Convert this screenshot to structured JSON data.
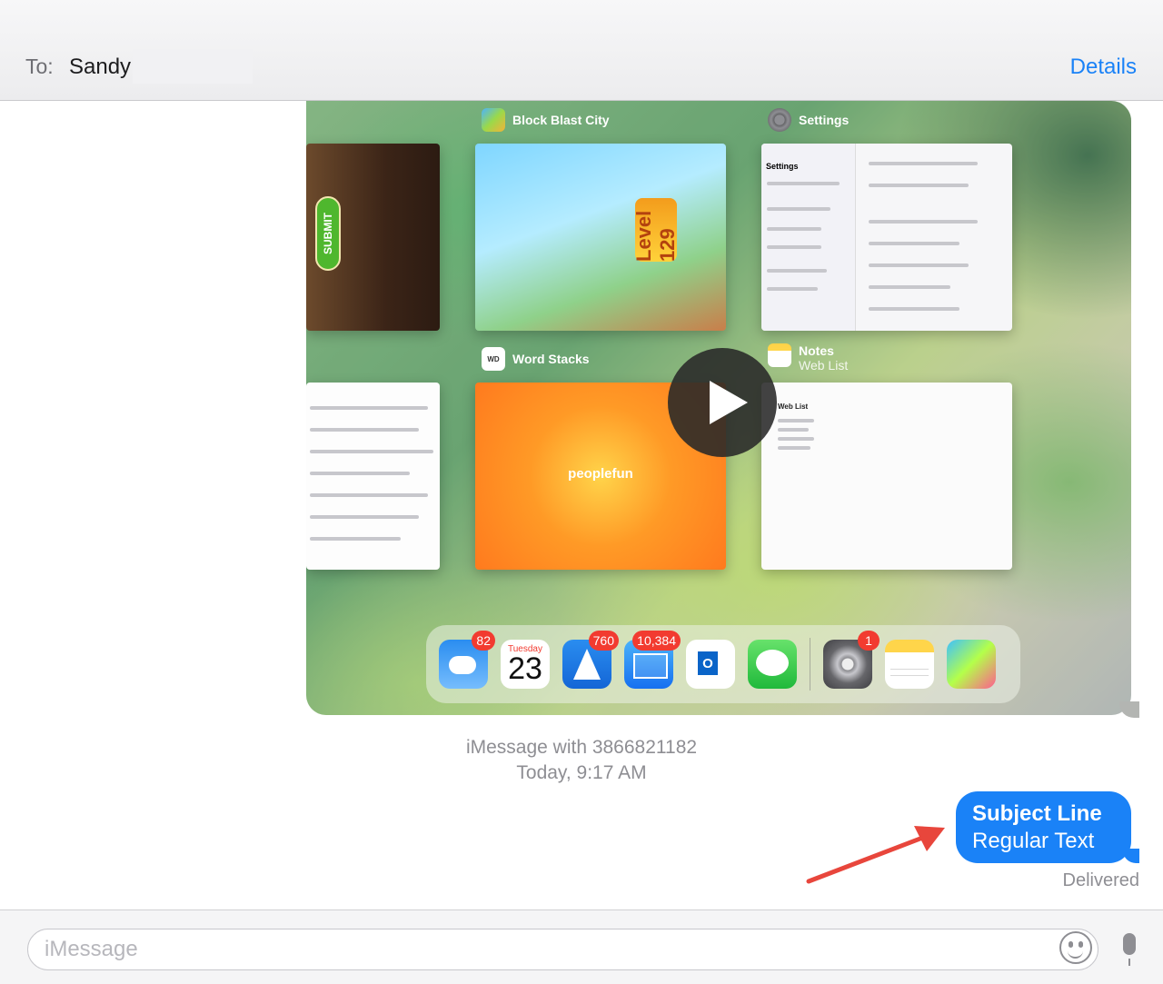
{
  "header": {
    "to_label": "To:",
    "recipient": "Sandy",
    "details_label": "Details",
    "accent": "#1a82f7"
  },
  "video": {
    "apps": [
      {
        "name": "Block Blast City",
        "subtitle": ""
      },
      {
        "name": "Settings",
        "subtitle": ""
      },
      {
        "name": "Word Stacks",
        "subtitle": ""
      },
      {
        "name": "Notes",
        "subtitle": "Web List"
      }
    ],
    "word_game_button": "SUBMIT",
    "block_level": "Level 129",
    "settings_title": "Settings",
    "notes_title": "Web List",
    "publisher": "peoplefun",
    "play_icon": "play-icon"
  },
  "dock": {
    "apps": [
      {
        "name": "weather-icon",
        "badge": "82"
      },
      {
        "name": "calendar-icon",
        "day": "Tuesday",
        "date": "23"
      },
      {
        "name": "spark-icon",
        "badge": "760"
      },
      {
        "name": "mail-icon",
        "badge": "10,384"
      },
      {
        "name": "outlook-icon"
      },
      {
        "name": "messages-icon"
      },
      {
        "name": "settings-icon",
        "badge": "1"
      },
      {
        "name": "notes-icon"
      },
      {
        "name": "block-game-icon"
      }
    ]
  },
  "meta": {
    "line1": "iMessage with 3866821182",
    "line2": "Today, 9:17 AM"
  },
  "message": {
    "subject": "Subject Line",
    "text": "Regular Text",
    "status": "Delivered",
    "bubble_color": "#1a82f7"
  },
  "input": {
    "placeholder": "iMessage"
  },
  "annotation": {
    "arrow_color": "#e8463c"
  }
}
